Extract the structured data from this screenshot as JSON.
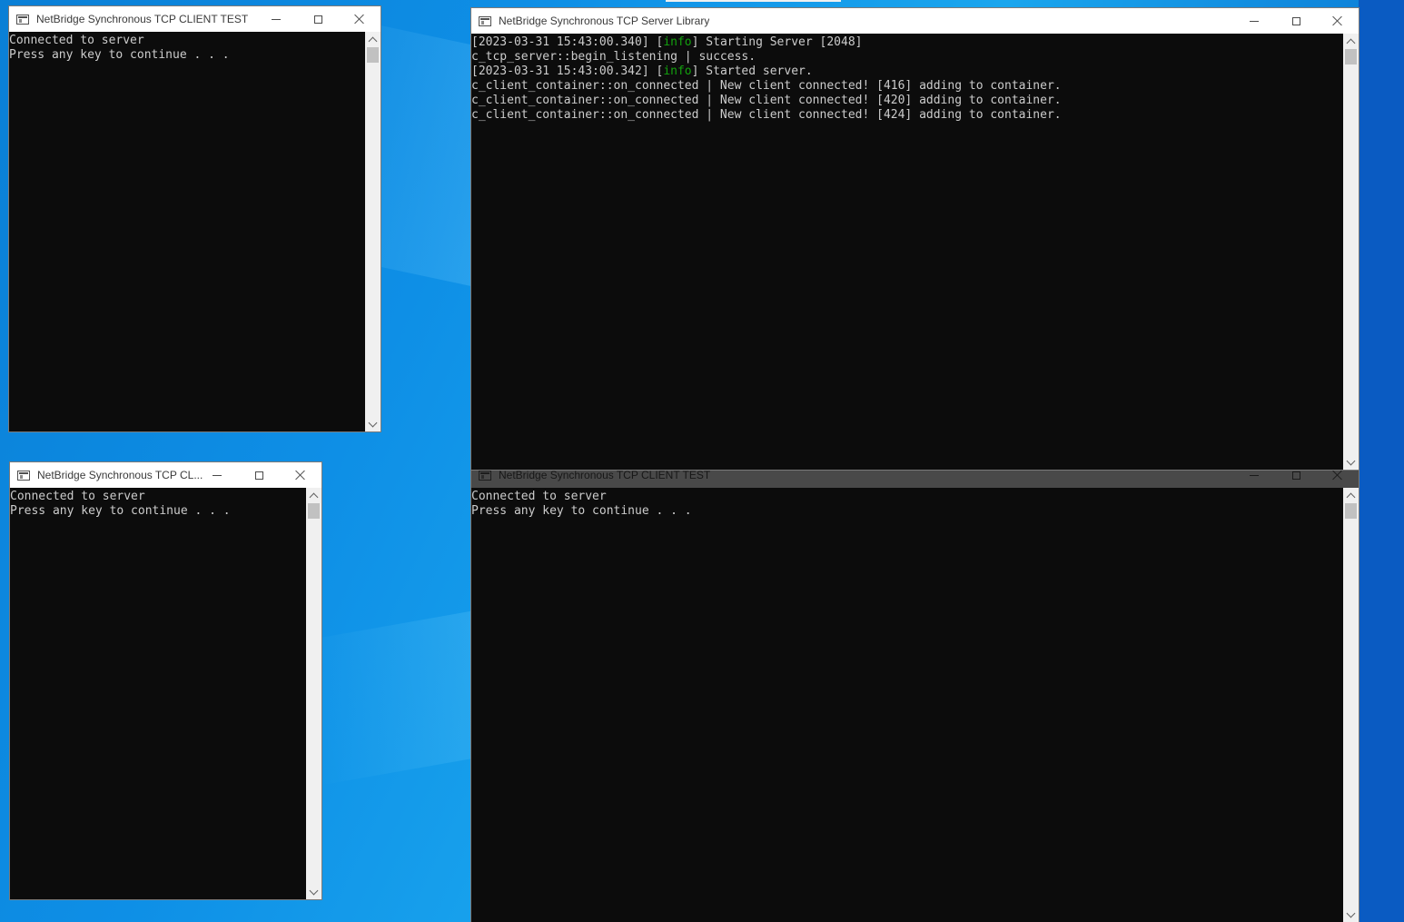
{
  "desktop": {
    "accent": "#0a7fd6"
  },
  "windows": {
    "client1": {
      "title": "NetBridge Synchronous TCP CLIENT TEST",
      "lines": [
        "Connected to server",
        "Press any key to continue . . ."
      ]
    },
    "client2": {
      "title": "NetBridge Synchronous TCP CL...",
      "lines": [
        "Connected to server",
        "Press any key to continue . . ."
      ]
    },
    "server": {
      "title": "NetBridge Synchronous TCP Server Library",
      "log": [
        {
          "prefix": "[2023-03-31 15:43:00.340] [",
          "level": "info",
          "suffix": "] Starting Server [2048]"
        },
        {
          "prefix": "c_tcp_server::begin_listening | success.",
          "level": "",
          "suffix": ""
        },
        {
          "prefix": "[2023-03-31 15:43:00.342] [",
          "level": "info",
          "suffix": "] Started server."
        },
        {
          "prefix": "c_client_container::on_connected | New client connected! [416] adding to container.",
          "level": "",
          "suffix": ""
        },
        {
          "prefix": "c_client_container::on_connected | New client connected! [420] adding to container.",
          "level": "",
          "suffix": ""
        },
        {
          "prefix": "c_client_container::on_connected | New client connected! [424] adding to container.",
          "level": "",
          "suffix": ""
        }
      ],
      "info_color": "#13a10e"
    },
    "client3": {
      "title": "NetBridge Synchronous TCP CLIENT TEST",
      "lines": [
        "Connected to server",
        "Press any key to continue . . ."
      ]
    }
  },
  "icons": {
    "app": "console-window-icon",
    "minimize": "minimize-icon",
    "maximize": "maximize-icon",
    "close": "close-icon",
    "scroll_up": "chevron-up-icon",
    "scroll_down": "chevron-down-icon"
  }
}
